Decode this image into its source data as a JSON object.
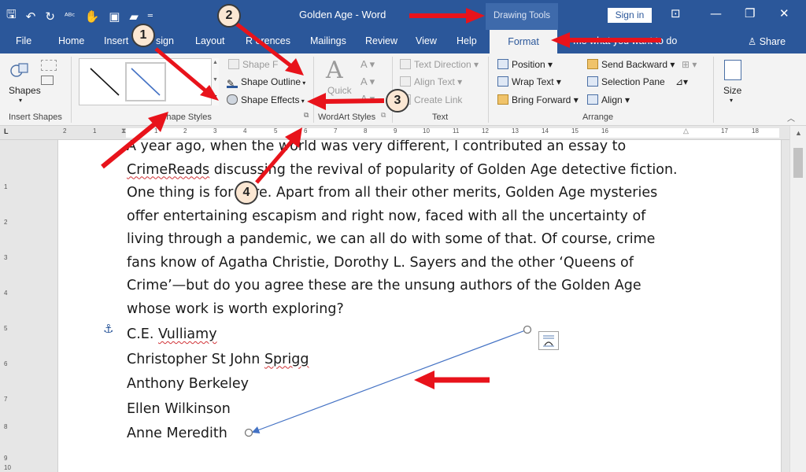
{
  "title_bar": {
    "document_title": "Golden Age  -  Word",
    "context_tools": "Drawing Tools",
    "sign_in": "Sign in",
    "qat_icons": [
      "save-icon",
      "undo-icon",
      "redo-icon",
      "spelling-icon",
      "touch-mode-icon",
      "print-preview-icon",
      "open-icon",
      "customize-icon"
    ]
  },
  "tabs": [
    "File",
    "Home",
    "Insert",
    "Design",
    "Layout",
    "References",
    "Mailings",
    "Review",
    "View",
    "Help"
  ],
  "tab_labels": {
    "file": "File",
    "home": "Home",
    "insert": "Insert",
    "design": "sign",
    "layout": "Layout",
    "references": "R   erences",
    "mailings": "Mailings",
    "review": "Review",
    "view": "View",
    "help": "Help"
  },
  "active_tab": "Format",
  "tell_me": "Tell me what you want to do",
  "tell_me_visible": "l me what you want to do",
  "share": "Share",
  "ribbon": {
    "insert_shapes": {
      "shapes_label": "Shapes",
      "group_label": "Insert Shapes"
    },
    "shape_styles": {
      "shape_fill": "Shape F",
      "shape_outline": "Shape Outline",
      "shape_effects": "Shape Effects",
      "group_label": "Shape Styles"
    },
    "wordart_styles": {
      "quick": "Quick",
      "group_label": "WordArt Styles"
    },
    "text": {
      "text_direction": "Text Direction",
      "align_text": "Align Text",
      "create_link": "Create Link",
      "group_label": "Text"
    },
    "arrange": {
      "position": "Position",
      "wrap_text": "Wrap Text",
      "bring_forward": "Bring Forward",
      "send_backward": "Send Backward",
      "selection_pane": "Selection Pane",
      "align": "Align",
      "group_label": "Arrange"
    },
    "size": {
      "label": "Size"
    }
  },
  "ruler_numbers": [
    "2",
    "1",
    "1",
    "2",
    "3",
    "4",
    "5",
    "6",
    "7",
    "8",
    "9",
    "10",
    "11",
    "12",
    "13",
    "14",
    "15",
    "16",
    "17",
    "18"
  ],
  "vruler_numbers": [
    "1",
    "2",
    "3",
    "4",
    "5",
    "6",
    "7",
    "8",
    "9",
    "10"
  ],
  "document": {
    "line1": "A year ago, when the world was very different, I contributed an essay to",
    "line2_a": "CrimeReads",
    "line2_b": " discussing the revival of popularity of Golden Age detective fiction.",
    "line3": "One thing is for sure. Apart from all their other merits, Golden Age mysteries",
    "line4": "offer entertaining escapism and right now, faced with all the uncertainty of",
    "line5": "living through a pandemic, we can all do with some of that. Of course, crime",
    "line6": "fans know of Agatha Christie, Dorothy L. Sayers and the other ‘Queens of",
    "line7": "Crime’—but do you agree these are the unsung authors of the Golden Age",
    "line8": "whose work is worth exploring?",
    "authors": [
      {
        "pre": "C.E. ",
        "squig": "Vulliamy",
        "post": ""
      },
      {
        "pre": "Christopher St John ",
        "squig": "Sprigg",
        "post": ""
      },
      {
        "pre": "Anthony Berkeley",
        "squig": "",
        "post": ""
      },
      {
        "pre": "Ellen Wilkinson",
        "squig": "",
        "post": ""
      },
      {
        "pre": "Anne Meredith",
        "squig": "",
        "post": ""
      }
    ]
  },
  "callouts": [
    "1",
    "2",
    "3",
    "4"
  ],
  "colors": {
    "accent": "#2b579a",
    "arrow": "#e8131b",
    "callout_fill": "#fbe7d3"
  }
}
